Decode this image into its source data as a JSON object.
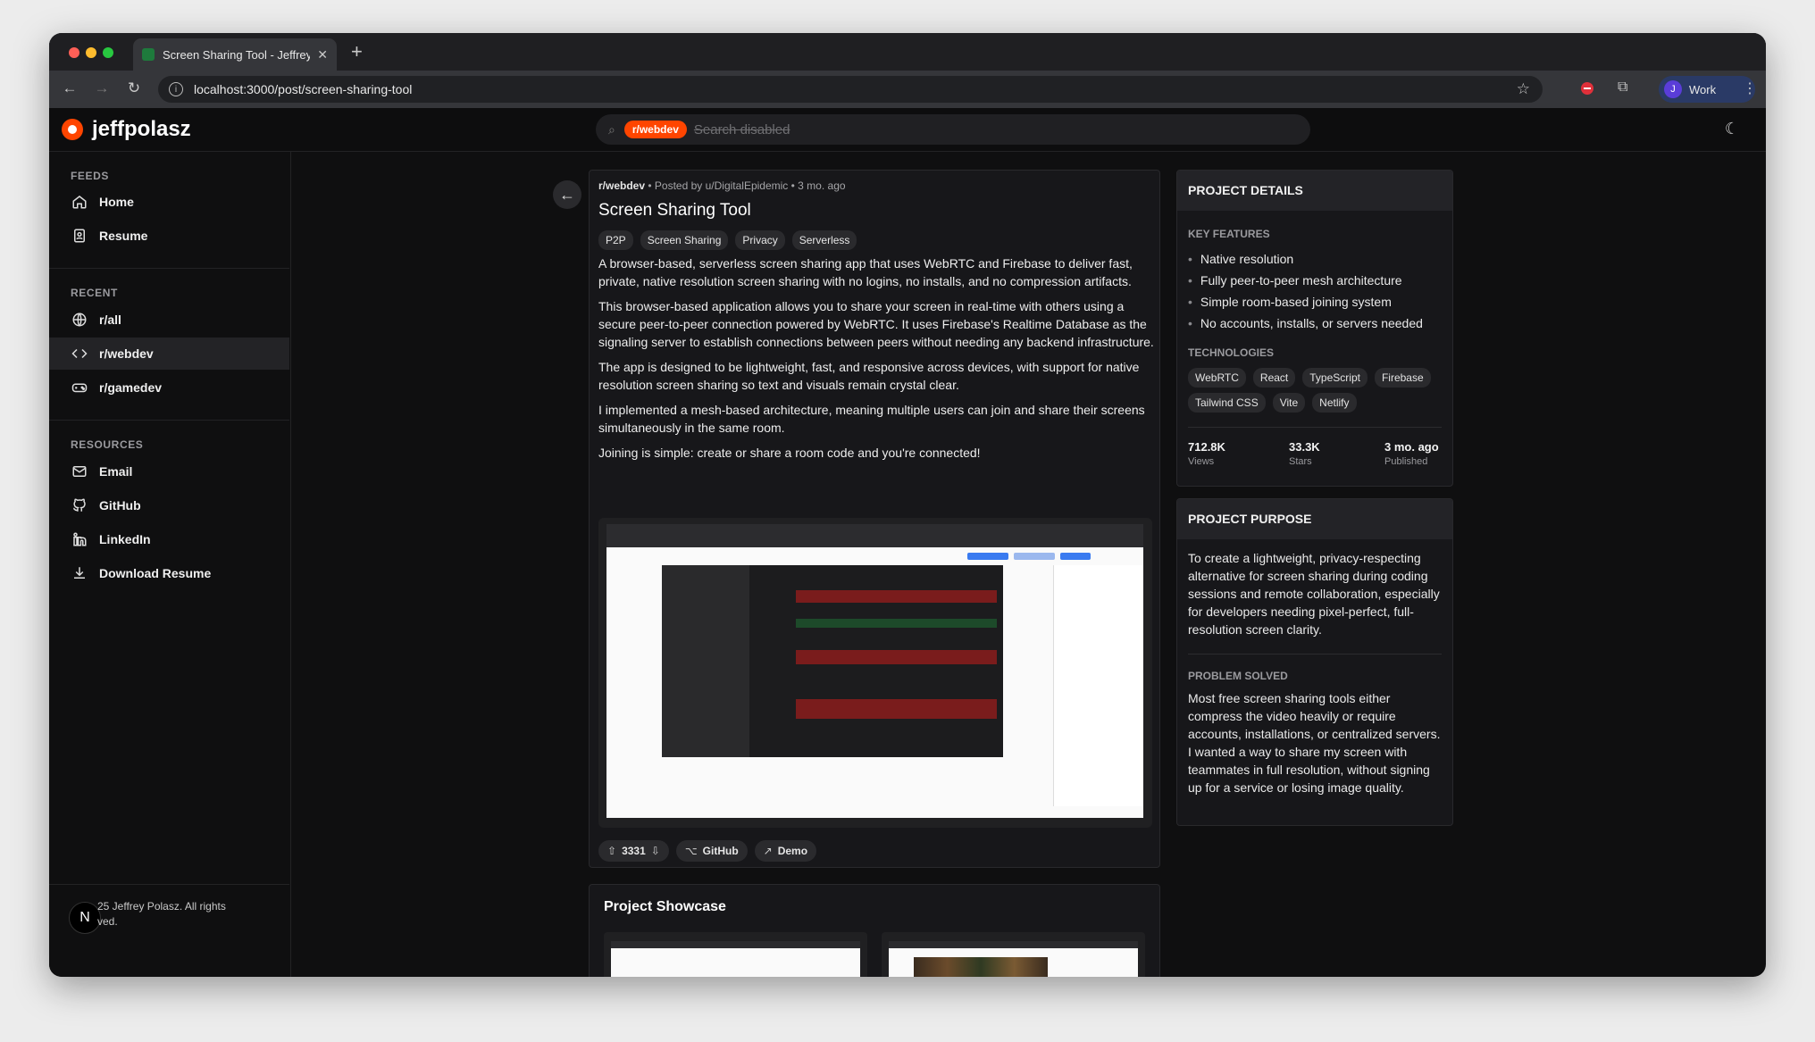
{
  "browser": {
    "tab_title": "Screen Sharing Tool - Jeffrey",
    "url": "localhost:3000/post/screen-sharing-tool",
    "profile_initial": "J",
    "profile_name": "Work"
  },
  "header": {
    "logo": "jeffpolasz",
    "search_chip": "r/webdev",
    "search_placeholder": "Search disabled"
  },
  "sidebar": {
    "feeds_title": "FEEDS",
    "feeds": [
      {
        "label": "Home",
        "icon": "home-icon"
      },
      {
        "label": "Resume",
        "icon": "resume-icon"
      }
    ],
    "recent_title": "RECENT",
    "recent": [
      {
        "label": "r/all",
        "icon": "globe-icon"
      },
      {
        "label": "r/webdev",
        "icon": "code-icon"
      },
      {
        "label": "r/gamedev",
        "icon": "gamepad-icon"
      }
    ],
    "resources_title": "RESOURCES",
    "resources": [
      {
        "label": "Email",
        "icon": "mail-icon"
      },
      {
        "label": "GitHub",
        "icon": "github-icon"
      },
      {
        "label": "LinkedIn",
        "icon": "linkedin-icon"
      },
      {
        "label": "Download Resume",
        "icon": "download-icon"
      }
    ],
    "copyright_line1": "25 Jeffrey Polasz. All rights",
    "copyright_line2": "ved.",
    "avatar": "N"
  },
  "post": {
    "subreddit": "r/webdev",
    "meta": " • Posted by u/DigitalEpidemic • 3 mo. ago",
    "title": "Screen Sharing Tool",
    "tags": [
      "P2P",
      "Screen Sharing",
      "Privacy",
      "Serverless"
    ],
    "paragraphs": [
      "A browser-based, serverless screen sharing app that uses WebRTC and Firebase to deliver fast, private, native resolution screen sharing with no logins, no installs, and no compression artifacts.",
      "This browser-based application allows you to share your screen in real-time with others using a secure peer-to-peer connection powered by WebRTC. It uses Firebase's Realtime Database as the signaling server to establish connections between peers without needing any backend infrastructure.",
      "The app is designed to be lightweight, fast, and responsive across devices, with support for native resolution screen sharing so text and visuals remain crystal clear.",
      "I implemented a mesh-based architecture, meaning multiple users can join and share their screens simultaneously in the same room.",
      "Joining is simple: create or share a room code and you're connected!"
    ],
    "votes": "3331",
    "github_label": "GitHub",
    "demo_label": "Demo"
  },
  "showcase": {
    "title": "Project Showcase"
  },
  "details": {
    "title": "PROJECT DETAILS",
    "features_label": "KEY FEATURES",
    "features": [
      "Native resolution",
      "Fully peer-to-peer mesh architecture",
      "Simple room-based joining system",
      "No accounts, installs, or servers needed"
    ],
    "tech_label": "TECHNOLOGIES",
    "technologies": [
      "WebRTC",
      "React",
      "TypeScript",
      "Firebase",
      "Tailwind CSS",
      "Vite",
      "Netlify"
    ],
    "stats": [
      {
        "value": "712.8K",
        "label": "Views"
      },
      {
        "value": "33.3K",
        "label": "Stars"
      },
      {
        "value": "3 mo. ago",
        "label": "Published"
      }
    ]
  },
  "purpose": {
    "title": "PROJECT PURPOSE",
    "text": "To create a lightweight, privacy-respecting alternative for screen sharing during coding sessions and remote collaboration, especially for developers needing pixel-perfect, full-resolution screen clarity.",
    "problem_label": "PROBLEM SOLVED",
    "problem_text": "Most free screen sharing tools either compress the video heavily or require accounts, installations, or centralized servers. I wanted a way to share my screen with teammates in full resolution, without signing up for a service or losing image quality."
  }
}
